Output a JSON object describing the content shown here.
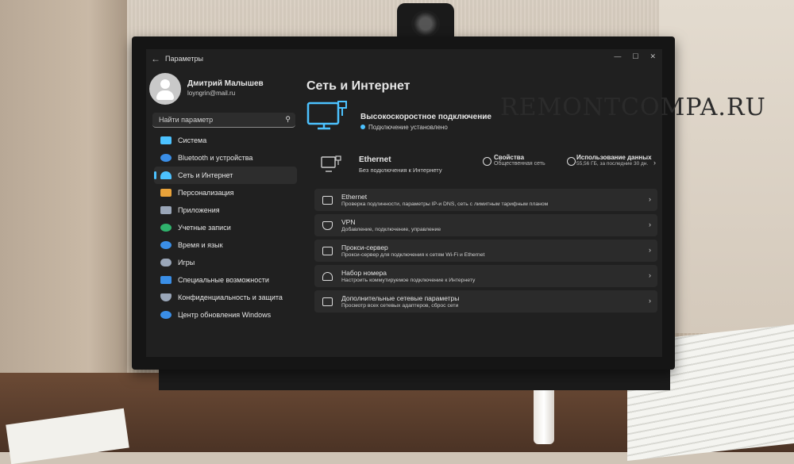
{
  "watermark": "REMONTCOMPA.RU",
  "window": {
    "back_icon": "arrow-left-icon",
    "title": "Параметры",
    "controls": [
      "—",
      "☐",
      "✕"
    ]
  },
  "user": {
    "name": "Дмитрий Малышев",
    "email": "loyngrin@mail.ru"
  },
  "search": {
    "placeholder": "Найти параметр"
  },
  "nav": {
    "items": [
      {
        "label": "Система",
        "icon": "monitor-icon",
        "color": "#4cc2ff"
      },
      {
        "label": "Bluetooth и устройства",
        "icon": "bluetooth-icon",
        "color": "#3a8ee6"
      },
      {
        "label": "Сеть и Интернет",
        "icon": "wifi-icon",
        "color": "#4cc2ff"
      },
      {
        "label": "Персонализация",
        "icon": "brush-icon",
        "color": "#e8a23a"
      },
      {
        "label": "Приложения",
        "icon": "apps-icon",
        "color": "#9aa6b8"
      },
      {
        "label": "Учетные записи",
        "icon": "person-icon",
        "color": "#2fb36c"
      },
      {
        "label": "Время и язык",
        "icon": "globe-icon",
        "color": "#3a8ee6"
      },
      {
        "label": "Игры",
        "icon": "gamepad-icon",
        "color": "#9aa6b8"
      },
      {
        "label": "Специальные возможности",
        "icon": "accessibility-icon",
        "color": "#3a8ee6"
      },
      {
        "label": "Конфиденциальность и защита",
        "icon": "shield-icon",
        "color": "#9aa6b8"
      },
      {
        "label": "Центр обновления Windows",
        "icon": "update-icon",
        "color": "#3a8ee6"
      }
    ],
    "active_index": 2
  },
  "main": {
    "title": "Сеть и Интернет",
    "hero": {
      "title": "Высокоскоростное подключение",
      "status": "Подключение установлено"
    },
    "ethernet": {
      "title": "Ethernet",
      "subtitle": "Без подключения к Интернету",
      "properties_title": "Свойства",
      "properties_sub": "Общественная сеть",
      "usage_title": "Использование данных",
      "usage_sub": "55,56 ГБ, за последние 30 дн."
    },
    "cards": [
      {
        "title": "Ethernet",
        "subtitle": "Проверка подлинности, параметры IP-и DNS, сеть с лимитным тарифным планом"
      },
      {
        "title": "VPN",
        "subtitle": "Добавление, подключение, управление"
      },
      {
        "title": "Прокси-сервер",
        "subtitle": "Прокси-сервер для подключения к сетям Wi-Fi и Ethernet"
      },
      {
        "title": "Набор номера",
        "subtitle": "Настроить коммутируемое подключение к Интернету"
      },
      {
        "title": "Дополнительные сетевые параметры",
        "subtitle": "Просмотр всех сетевых адаптеров, сброс сети"
      }
    ]
  }
}
